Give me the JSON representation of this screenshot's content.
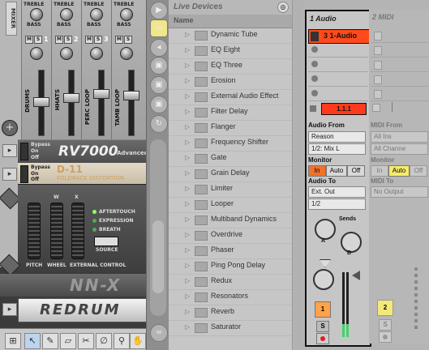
{
  "reason_rack": {
    "mixer_label": "MIXER",
    "treble_label": "TREBLE",
    "bass_label": "BASS",
    "channel_numbers": [
      "1",
      "2",
      "3"
    ],
    "channels": [
      "DRUMS",
      "HHATS",
      "PERC LOOP",
      "TAMB LOOP"
    ],
    "bypass_label": "Bypass",
    "on_label": "On",
    "off_label": "Off",
    "rv7000_name": "RV7000",
    "rv7000_sub": "Advanced",
    "d11_name": "D-11",
    "d11_sub": "FOLDBACK DISTORTION",
    "wheel_header": [
      "W",
      "X"
    ],
    "aftertouch": "AFTERTOUCH",
    "expression": "EXPRESSION",
    "breath": "BREATH",
    "source": "SOURCE",
    "pitch": "PITCH",
    "wheel": "WHEEL",
    "external_control": "EXTERNAL CONTROL",
    "nnx_name": "NN-X",
    "redrum_name": "REDRUM"
  },
  "browser": {
    "title": "Live Devices",
    "column_header": "Name",
    "items": [
      "Dynamic Tube",
      "EQ Eight",
      "EQ Three",
      "Erosion",
      "External Audio Effect",
      "Filter Delay",
      "Flanger",
      "Frequency Shifter",
      "Gate",
      "Grain Delay",
      "Limiter",
      "Looper",
      "Multiband Dynamics",
      "Overdrive",
      "Phaser",
      "Ping Pong Delay",
      "Redux",
      "Resonators",
      "Reverb",
      "Saturator"
    ]
  },
  "session": {
    "track1": {
      "title": "1 Audio",
      "clip_name": "3 1-Audio",
      "position": "1.1.1",
      "audio_from_label": "Audio From",
      "audio_from_value": "Reason",
      "audio_from_channel": "1/2: Mix L",
      "monitor_label": "Monitor",
      "monitor_in": "In",
      "monitor_auto": "Auto",
      "monitor_off": "Off",
      "audio_to_label": "Audio To",
      "audio_to_value": "Ext. Out",
      "audio_to_channel": "1/2",
      "sends_label": "Sends",
      "send_a": "A",
      "send_b": "B",
      "track_number": "1",
      "solo": "S",
      "record_color": "#e02020"
    },
    "track2": {
      "title": "2 MIDI",
      "midi_from_label": "MIDI From",
      "midi_from_value": "All Ins",
      "midi_from_channel": "All Channe",
      "monitor_label": "Monitor",
      "monitor_in": "In",
      "monitor_auto": "Auto",
      "monitor_off": "Off",
      "midi_to_label": "MIDI To",
      "midi_to_value": "No Output",
      "track_number": "2",
      "solo": "S"
    }
  },
  "colors": {
    "track1_clip": "#ff4a1c",
    "track_on_orange": "#ffa24a",
    "track2_yellow": "#f4e87a",
    "meter_green": "#43d36b",
    "monitor_in_orange": "#f0722a",
    "monitor_auto_yellow": "#f6ec6a"
  }
}
